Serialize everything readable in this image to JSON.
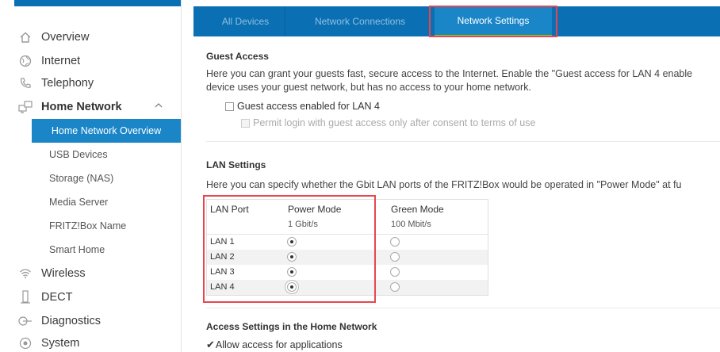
{
  "tabs": [
    {
      "label": "All Devices",
      "active": false
    },
    {
      "label": "Network Connections",
      "active": false
    },
    {
      "label": "Network Settings",
      "active": true
    }
  ],
  "sidebar": {
    "items": [
      {
        "label": "Overview",
        "icon": "home-icon"
      },
      {
        "label": "Internet",
        "icon": "globe-icon"
      },
      {
        "label": "Telephony",
        "icon": "phone-icon"
      },
      {
        "label": "Home Network",
        "icon": "network-icon",
        "expanded": true
      },
      {
        "label": "Wireless",
        "icon": "wifi-icon"
      },
      {
        "label": "DECT",
        "icon": "dect-icon"
      },
      {
        "label": "Diagnostics",
        "icon": "diagnostics-icon"
      },
      {
        "label": "System",
        "icon": "system-icon"
      }
    ],
    "subitems": [
      {
        "label": "Home Network Overview",
        "active": true
      },
      {
        "label": "USB Devices"
      },
      {
        "label": "Storage (NAS)"
      },
      {
        "label": "Media Server"
      },
      {
        "label": "FRITZ!Box Name"
      },
      {
        "label": "Smart Home"
      }
    ]
  },
  "guest": {
    "title": "Guest Access",
    "line1": "Here you can grant your guests fast, secure access to the Internet. Enable the \"Guest access for LAN 4 enable",
    "line2": "device uses your guest network, but has no access to your home network.",
    "checkbox1": "Guest access enabled for LAN 4",
    "checkbox2": "Permit login with guest access only after consent to terms of use"
  },
  "lan": {
    "title": "LAN Settings",
    "desc": "Here you can specify whether the Gbit LAN ports of the FRITZ!Box would be operated in \"Power Mode\" at fu",
    "col_port": "LAN Port",
    "col_power": "Power Mode",
    "col_power_speed": "1 Gbit/s",
    "col_green": "Green Mode",
    "col_green_speed": "100 Mbit/s",
    "rows": [
      {
        "port": "LAN 1",
        "mode": "power"
      },
      {
        "port": "LAN 2",
        "mode": "power"
      },
      {
        "port": "LAN 3",
        "mode": "power"
      },
      {
        "port": "LAN 4",
        "mode": "power"
      }
    ]
  },
  "access": {
    "title": "Access Settings in the Home Network",
    "allow_apps": "Allow access for applications"
  },
  "colors": {
    "brand_blue": "#0b6fb3",
    "active_blue": "#1a86c8",
    "annotation_red": "#e8464f",
    "tab_underline": "#8fd400"
  }
}
